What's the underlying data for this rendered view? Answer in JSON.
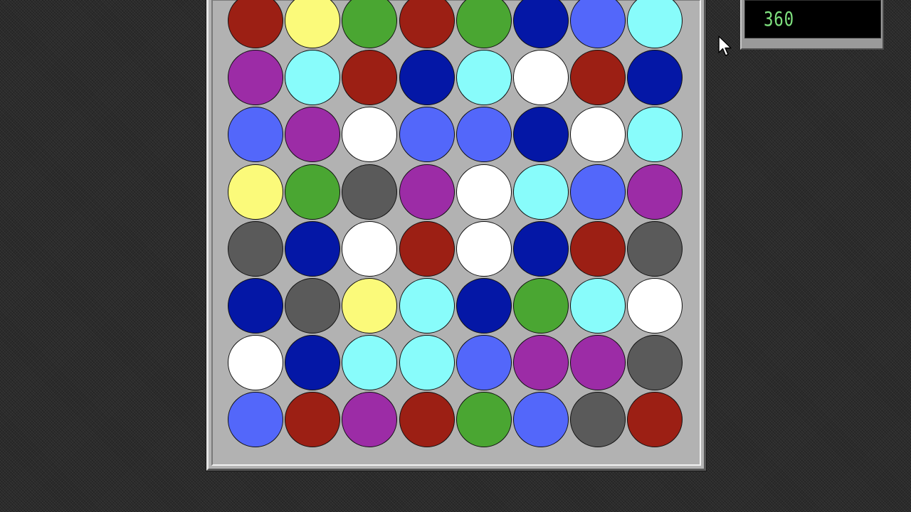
{
  "score": {
    "value": "360"
  },
  "palette": {
    "R": "#9c1f14",
    "Y": "#fbfa7a",
    "G": "#4aa632",
    "N": "#0417a6",
    "B": "#5367fa",
    "C": "#88fcfb",
    "P": "#9c2ca6",
    "W": "#ffffff",
    "D": "#5a5a5a"
  },
  "colors": {
    "background": "#2b2b2b",
    "board": "#b4b4b4",
    "score_text": "#7ee07e"
  },
  "grid": [
    [
      "R",
      "Y",
      "G",
      "R",
      "G",
      "N",
      "B",
      "C"
    ],
    [
      "P",
      "C",
      "R",
      "N",
      "C",
      "W",
      "R",
      "N"
    ],
    [
      "B",
      "P",
      "W",
      "B",
      "B",
      "N",
      "W",
      "C"
    ],
    [
      "Y",
      "G",
      "D",
      "P",
      "W",
      "C",
      "B",
      "P"
    ],
    [
      "D",
      "N",
      "W",
      "R",
      "W",
      "N",
      "R",
      "D"
    ],
    [
      "N",
      "D",
      "Y",
      "C",
      "N",
      "G",
      "C",
      "W"
    ],
    [
      "W",
      "N",
      "C",
      "C",
      "B",
      "P",
      "P",
      "D"
    ],
    [
      "B",
      "R",
      "P",
      "R",
      "G",
      "B",
      "D",
      "R"
    ]
  ],
  "cursor": "arrow-pointer-icon"
}
